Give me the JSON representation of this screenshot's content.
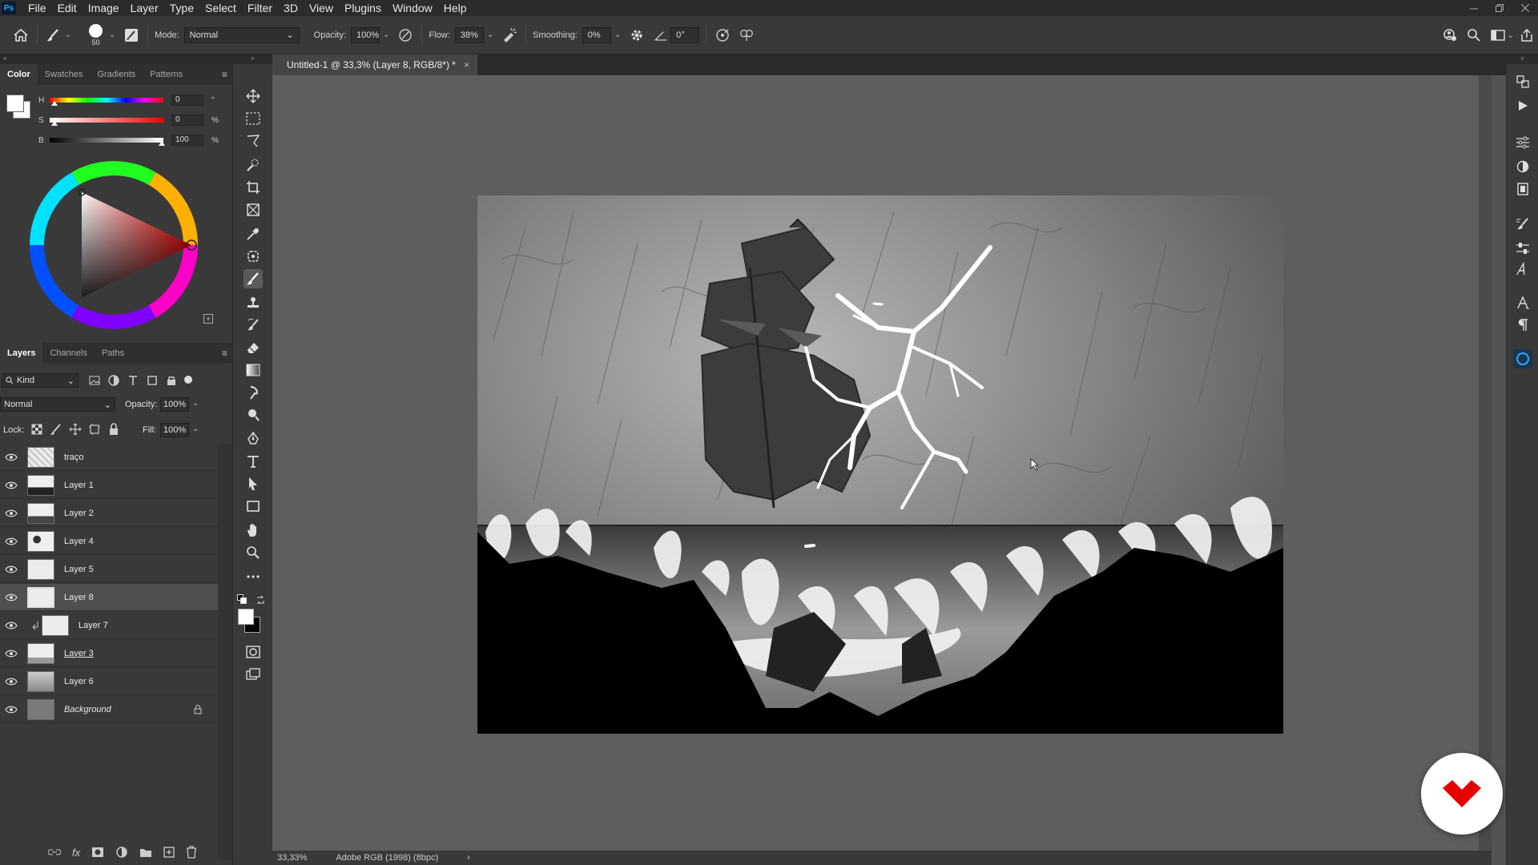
{
  "app": {
    "logo": "Ps"
  },
  "menubar": {
    "items": [
      "File",
      "Edit",
      "Image",
      "Layer",
      "Type",
      "Select",
      "Filter",
      "3D",
      "View",
      "Plugins",
      "Window",
      "Help"
    ]
  },
  "options": {
    "brush_size": "50",
    "mode_label": "Mode:",
    "mode_value": "Normal",
    "opacity_label": "Opacity:",
    "opacity_value": "100%",
    "flow_label": "Flow:",
    "flow_value": "38%",
    "smoothing_label": "Smoothing:",
    "smoothing_value": "0%",
    "angle_value": "0°"
  },
  "color_panel": {
    "tabs": [
      "Color",
      "Swatches",
      "Gradients",
      "Patterns"
    ],
    "h_label": "H",
    "h_value": "0",
    "h_unit": "°",
    "s_label": "S",
    "s_value": "0",
    "s_unit": "%",
    "b_label": "B",
    "b_value": "100",
    "b_unit": "%"
  },
  "layers_panel": {
    "tabs": [
      "Layers",
      "Channels",
      "Paths"
    ],
    "filter_kind": "Kind",
    "blend_mode": "Normal",
    "opacity_label": "Opacity:",
    "opacity_value": "100%",
    "lock_label": "Lock:",
    "fill_label": "Fill:",
    "fill_value": "100%",
    "layers": [
      {
        "name": "traço"
      },
      {
        "name": "Layer 1"
      },
      {
        "name": "Layer 2"
      },
      {
        "name": "Layer 4"
      },
      {
        "name": "Layer 5"
      },
      {
        "name": "Layer 8"
      },
      {
        "name": "Layer 7"
      },
      {
        "name": "Layer 3"
      },
      {
        "name": "Layer 6"
      },
      {
        "name": "Background"
      }
    ]
  },
  "document": {
    "tab_title": "Untitled-1 @ 33,3% (Layer 8, RGB/8*) *",
    "close_glyph": "×"
  },
  "status": {
    "zoom": "33,33%",
    "profile": "Adobe RGB (1998) (8bpc)",
    "arrow": "›"
  },
  "colors": {
    "accent": "#31a8ff",
    "logo_red": "#e60000"
  }
}
